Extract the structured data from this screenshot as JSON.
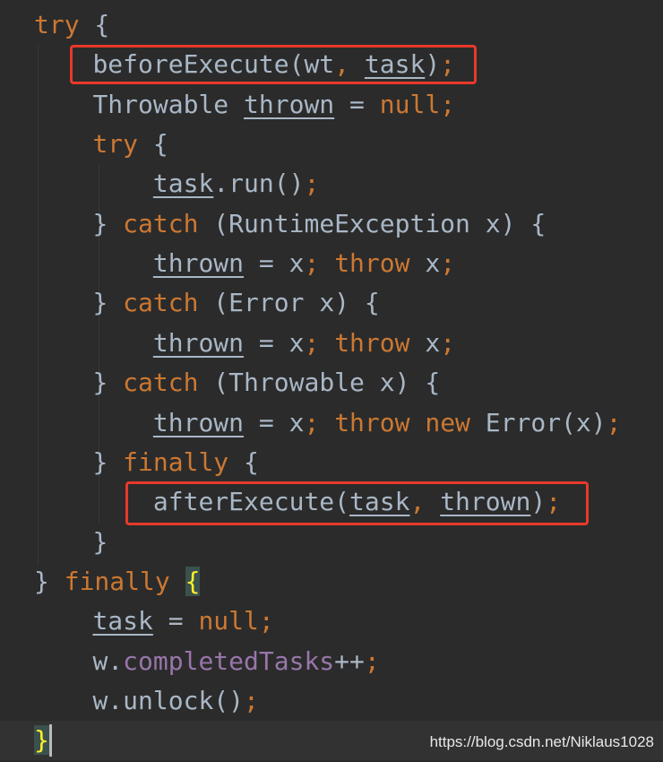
{
  "editor": {
    "colors": {
      "background": "#2b2b2b",
      "text": "#a9b7c6",
      "keyword": "#cc7832",
      "field": "#9876aa",
      "brace_match": "#ffef28",
      "highlight_box": "#e8392a"
    },
    "lines": [
      {
        "indent": 1,
        "tokens": [
          [
            "kw",
            "try"
          ],
          [
            "text",
            " {"
          ]
        ]
      },
      {
        "indent": 2,
        "tokens": [
          [
            "text",
            "beforeExecute(wt"
          ],
          [
            "punct",
            ", "
          ],
          [
            "under",
            "task"
          ],
          [
            "text",
            ")"
          ],
          [
            "punct",
            ";"
          ]
        ]
      },
      {
        "indent": 2,
        "tokens": [
          [
            "text",
            "Throwable "
          ],
          [
            "under",
            "thrown"
          ],
          [
            "text",
            " = "
          ],
          [
            "kw",
            "null"
          ],
          [
            "punct",
            ";"
          ]
        ]
      },
      {
        "indent": 2,
        "tokens": [
          [
            "kw",
            "try"
          ],
          [
            "text",
            " {"
          ]
        ]
      },
      {
        "indent": 3,
        "tokens": [
          [
            "under",
            "task"
          ],
          [
            "text",
            ".run()"
          ],
          [
            "punct",
            ";"
          ]
        ]
      },
      {
        "indent": 2,
        "tokens": [
          [
            "text",
            "} "
          ],
          [
            "kw",
            "catch"
          ],
          [
            "text",
            " (RuntimeException x) {"
          ]
        ]
      },
      {
        "indent": 3,
        "tokens": [
          [
            "under",
            "thrown"
          ],
          [
            "text",
            " = x"
          ],
          [
            "punct",
            "; "
          ],
          [
            "kw",
            "throw"
          ],
          [
            "text",
            " x"
          ],
          [
            "punct",
            ";"
          ]
        ]
      },
      {
        "indent": 2,
        "tokens": [
          [
            "text",
            "} "
          ],
          [
            "kw",
            "catch"
          ],
          [
            "text",
            " (Error x) {"
          ]
        ]
      },
      {
        "indent": 3,
        "tokens": [
          [
            "under",
            "thrown"
          ],
          [
            "text",
            " = x"
          ],
          [
            "punct",
            "; "
          ],
          [
            "kw",
            "throw"
          ],
          [
            "text",
            " x"
          ],
          [
            "punct",
            ";"
          ]
        ]
      },
      {
        "indent": 2,
        "tokens": [
          [
            "text",
            "} "
          ],
          [
            "kw",
            "catch"
          ],
          [
            "text",
            " (Throwable x) {"
          ]
        ]
      },
      {
        "indent": 3,
        "tokens": [
          [
            "under",
            "thrown"
          ],
          [
            "text",
            " = x"
          ],
          [
            "punct",
            "; "
          ],
          [
            "kw",
            "throw new"
          ],
          [
            "text",
            " Error(x)"
          ],
          [
            "punct",
            ";"
          ]
        ]
      },
      {
        "indent": 2,
        "tokens": [
          [
            "text",
            "} "
          ],
          [
            "kw",
            "finally"
          ],
          [
            "text",
            " {"
          ]
        ]
      },
      {
        "indent": 3,
        "tokens": [
          [
            "text",
            "afterExecute("
          ],
          [
            "under",
            "task"
          ],
          [
            "punct",
            ", "
          ],
          [
            "under",
            "thrown"
          ],
          [
            "text",
            ")"
          ],
          [
            "punct",
            ";"
          ]
        ]
      },
      {
        "indent": 2,
        "tokens": [
          [
            "text",
            "}"
          ]
        ]
      },
      {
        "indent": 1,
        "tokens": [
          [
            "text",
            "} "
          ],
          [
            "kw",
            "finally"
          ],
          [
            "text",
            " "
          ],
          [
            "match",
            "{"
          ]
        ]
      },
      {
        "indent": 2,
        "tokens": [
          [
            "under",
            "task"
          ],
          [
            "text",
            " = "
          ],
          [
            "kw",
            "null"
          ],
          [
            "punct",
            ";"
          ]
        ]
      },
      {
        "indent": 2,
        "tokens": [
          [
            "text",
            "w."
          ],
          [
            "field",
            "completedTasks"
          ],
          [
            "text",
            "++"
          ],
          [
            "punct",
            ";"
          ]
        ]
      },
      {
        "indent": 2,
        "tokens": [
          [
            "text",
            "w.unlock()"
          ],
          [
            "punct",
            ";"
          ]
        ]
      },
      {
        "indent": 1,
        "current": true,
        "tokens": [
          [
            "match",
            "}"
          ]
        ]
      }
    ]
  },
  "watermark": "https://blog.csdn.net/Niklaus1028"
}
